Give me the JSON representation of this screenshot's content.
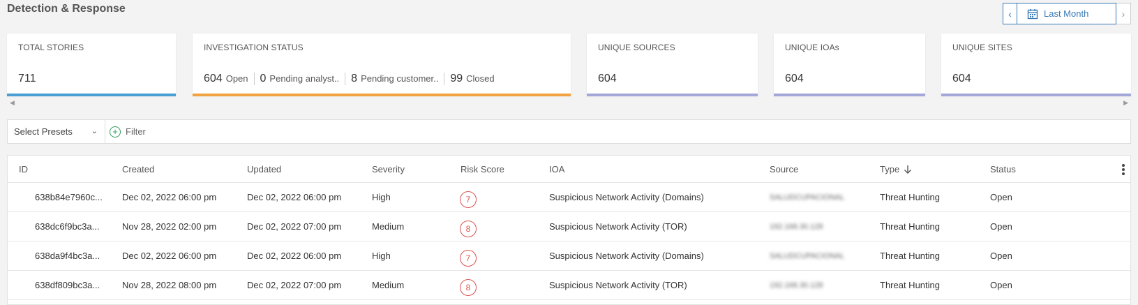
{
  "page": {
    "title": "Detection & Response"
  },
  "date_range": {
    "label": "Last Month",
    "prev_icon": "chevron-left-icon",
    "next_icon": "chevron-right-icon",
    "calendar_icon": "calendar-icon"
  },
  "cards": {
    "total_stories": {
      "title": "TOTAL STORIES",
      "value": "711",
      "color": "#4a9fd4"
    },
    "investigation_status": {
      "title": "INVESTIGATION STATUS",
      "color": "#f0a340",
      "items": [
        {
          "count": "604",
          "label": "Open"
        },
        {
          "count": "0",
          "label": "Pending analyst.."
        },
        {
          "count": "8",
          "label": "Pending customer.."
        },
        {
          "count": "99",
          "label": "Closed"
        }
      ]
    },
    "unique_sources": {
      "title": "UNIQUE SOURCES",
      "value": "604",
      "color": "#a3a8d8"
    },
    "unique_ioas": {
      "title": "UNIQUE IOAs",
      "value": "604",
      "color": "#a3a8d8"
    },
    "unique_sites": {
      "title": "UNIQUE SITES",
      "value": "604",
      "color": "#a3a8d8"
    }
  },
  "filter": {
    "preset_label": "Select Presets",
    "filter_label": "Filter"
  },
  "table": {
    "columns": {
      "id": "ID",
      "created": "Created",
      "updated": "Updated",
      "severity": "Severity",
      "risk": "Risk Score",
      "ioa": "IOA",
      "source": "Source",
      "type": "Type",
      "status": "Status"
    },
    "rows": [
      {
        "id": "638b84e7960c...",
        "created": "Dec 02, 2022 06:00 pm",
        "updated": "Dec 02, 2022 06:00 pm",
        "severity": "High",
        "risk": "7",
        "ioa": "Suspicious Network Activity (Domains)",
        "source": "SALUDCUPACIONAL",
        "type": "Threat Hunting",
        "status": "Open"
      },
      {
        "id": "638dc6f9bc3a...",
        "created": "Nov 28, 2022 02:00 pm",
        "updated": "Dec 02, 2022 07:00 pm",
        "severity": "Medium",
        "risk": "8",
        "ioa": "Suspicious Network Activity (TOR)",
        "source": "192.168.30.128",
        "type": "Threat Hunting",
        "status": "Open"
      },
      {
        "id": "638da9f4bc3a...",
        "created": "Dec 02, 2022 06:00 pm",
        "updated": "Dec 02, 2022 06:00 pm",
        "severity": "High",
        "risk": "7",
        "ioa": "Suspicious Network Activity (Domains)",
        "source": "SALUDCUPACIONAL",
        "type": "Threat Hunting",
        "status": "Open"
      },
      {
        "id": "638df809bc3a...",
        "created": "Nov 28, 2022 08:00 pm",
        "updated": "Dec 02, 2022 07:00 pm",
        "severity": "Medium",
        "risk": "8",
        "ioa": "Suspicious Network Activity (TOR)",
        "source": "192.168.30.128",
        "type": "Threat Hunting",
        "status": "Open"
      }
    ]
  }
}
